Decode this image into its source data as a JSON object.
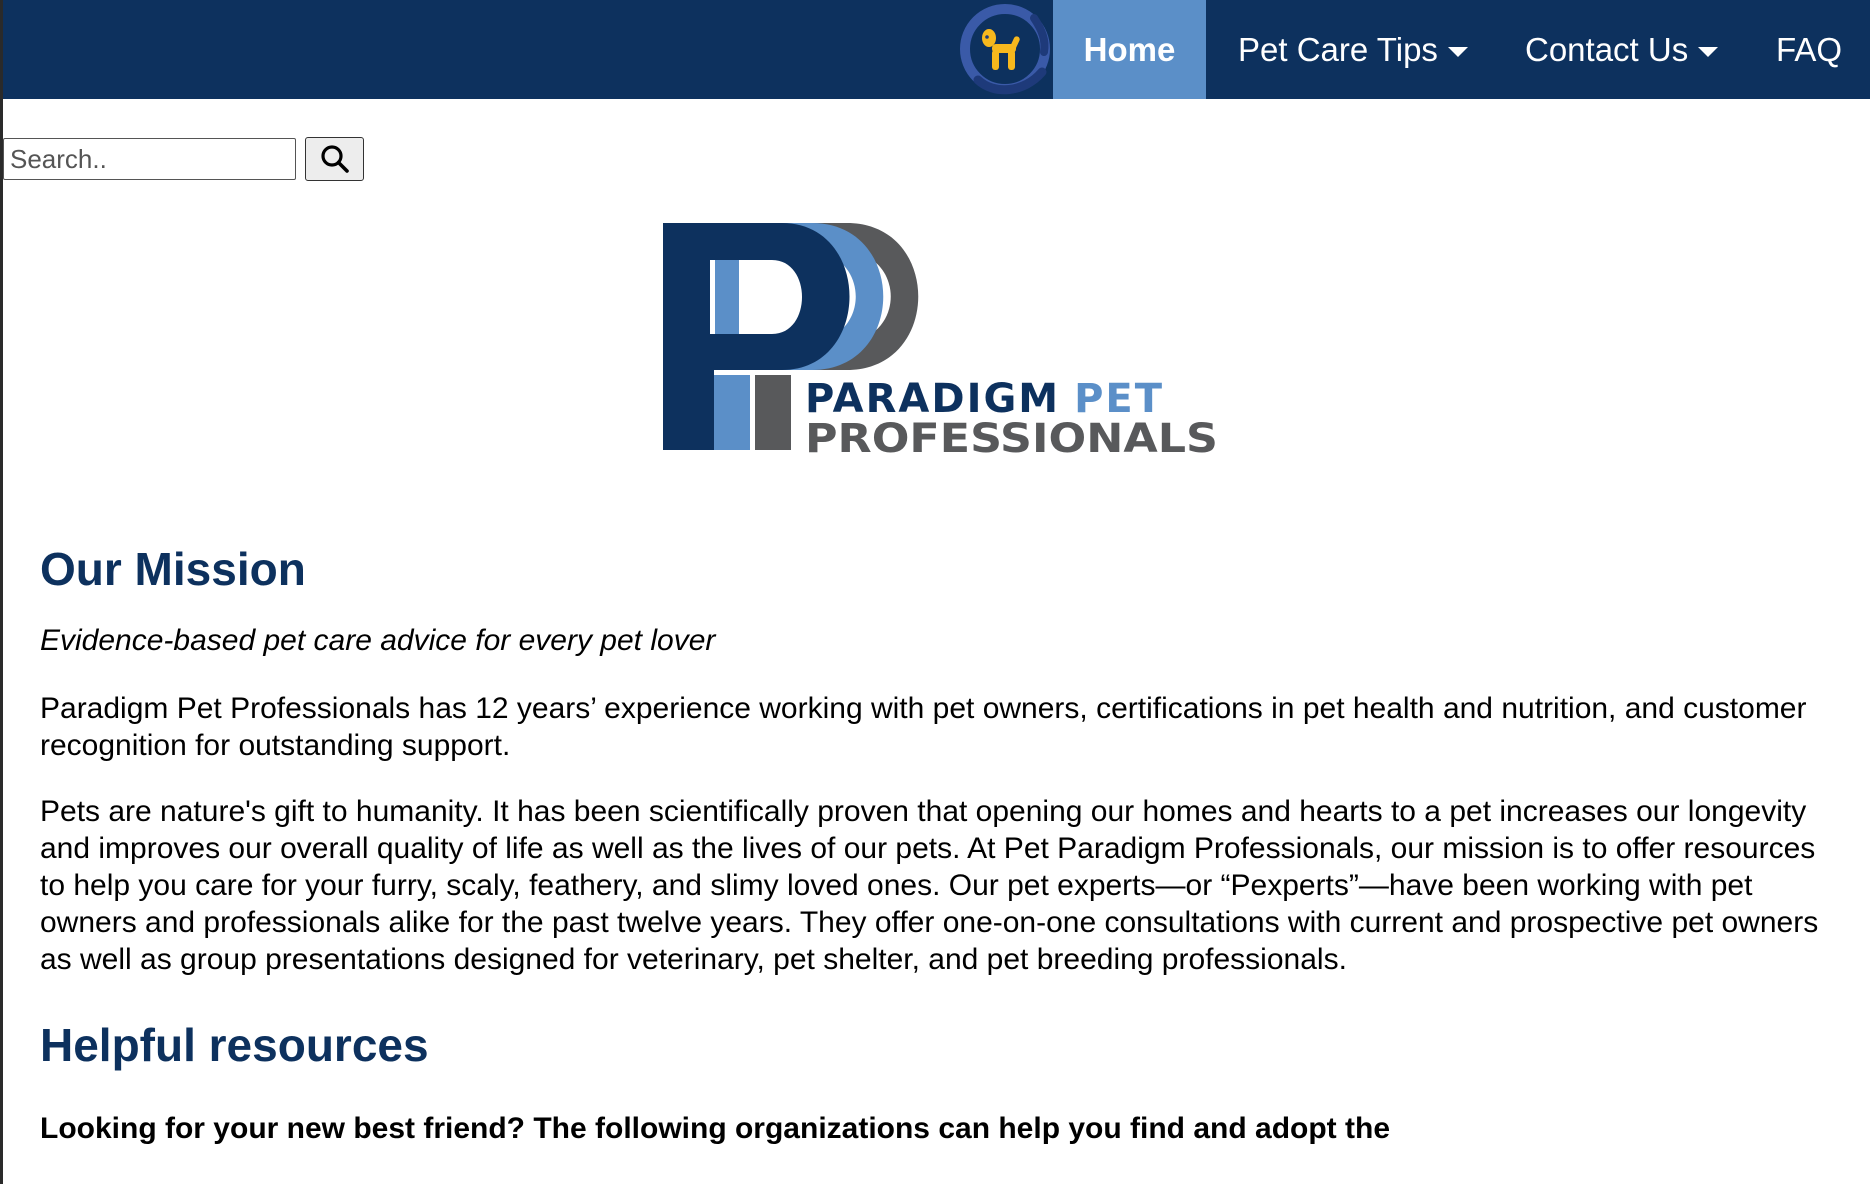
{
  "nav": {
    "items": [
      {
        "label": "Home",
        "active": true
      },
      {
        "label": "Pet Care Tips",
        "dropdown": true
      },
      {
        "label": "Contact Us",
        "dropdown": true
      },
      {
        "label": "FAQ"
      }
    ]
  },
  "search": {
    "placeholder": "Search..",
    "value": "",
    "button_icon": "search-icon"
  },
  "logo": {
    "line1_a": "PARADIGM",
    "line1_b": "PET",
    "line2": "PROFESSIONALS"
  },
  "main": {
    "mission_title": "Our Mission",
    "tagline": "Evidence-based pet care advice for every pet lover",
    "paragraph1": "Paradigm Pet Professionals has 12 years’ experience working with pet owners, certifications in pet health and nutrition, and customer recognition for outstanding support.",
    "paragraph2": "Pets are nature's gift to humanity. It has been scientifically proven that opening our homes and hearts to a pet increases our longevity and improves our overall quality of life as well as the lives of our pets. At Pet Paradigm Professionals, our mission is to offer resources to help you care for your furry, scaly, feathery, and slimy loved ones. Our pet experts—or “Pexperts”—have been working with pet owners and professionals alike for the past twelve years. They offer one-on-one consultations with current and prospective pet owners as well as group presentations designed for veterinary, pet shelter, and pet breeding professionals.",
    "resources_title": "Helpful resources",
    "resources_lead": "Looking for your new best friend? The following organizations can help you find and adopt the"
  },
  "colors": {
    "navbar": "#0d315e",
    "nav_active": "#5b8fc8",
    "heading": "#0d315e",
    "logo_light_blue": "#5b8fc8",
    "logo_gray": "#58595b",
    "mascot_yellow": "#f7b81d"
  }
}
